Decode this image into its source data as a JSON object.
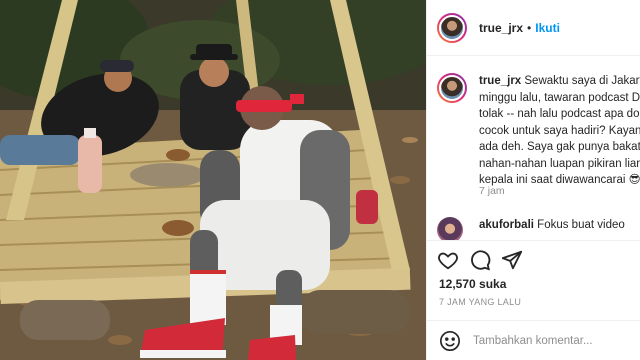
{
  "photo": {
    "alt_subject": "photo"
  },
  "post": {
    "username": "true_jrx",
    "separator": "•",
    "follow_label": "Ikuti"
  },
  "caption": {
    "username": "true_jrx",
    "lines": [
      "Sewaktu saya di Jakart",
      "minggu lalu, tawaran podcast D",
      "tolak -- nah lalu podcast apa do",
      "cocok untuk saya hadiri? Kayan",
      "ada deh. Saya gak punya bakat",
      "nahan-nahan luapan pikiran liar",
      "kepala ini saat diwawancarai 😎"
    ],
    "time": "7 jam"
  },
  "comment": {
    "username": "akuforbali",
    "text": "Fokus buat video",
    "partial": "...................."
  },
  "actions": {
    "icons": [
      "heart-icon",
      "comment-icon",
      "share-icon"
    ],
    "likes": "12,570 suka",
    "post_time": "7 JAM YANG LALU"
  },
  "comment_box": {
    "placeholder": "Tambahkan komentar...",
    "emoji_icon": "smiley-icon"
  },
  "colors": {
    "accent": "#0095f6",
    "text": "#262626",
    "muted": "#8e8e8e",
    "divider": "#efefef"
  }
}
